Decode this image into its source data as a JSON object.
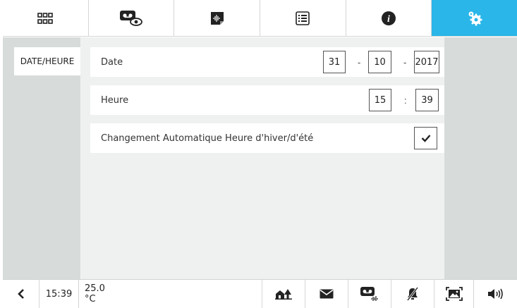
{
  "top_nav": {
    "tabs": [
      {
        "icon": "grid-icon"
      },
      {
        "icon": "voicemail-eye-icon"
      },
      {
        "icon": "audio-note-icon"
      },
      {
        "icon": "list-icon"
      },
      {
        "icon": "info-icon"
      },
      {
        "icon": "settings-gears-icon",
        "active": true
      }
    ]
  },
  "sidebar": {
    "items": [
      {
        "label": "DATE/HEURE"
      }
    ]
  },
  "date_row": {
    "label": "Date",
    "day": "31",
    "month": "10",
    "year": "2017",
    "sep": "-"
  },
  "time_row": {
    "label": "Heure",
    "hour": "15",
    "minute": "39",
    "sep": ":"
  },
  "dst_row": {
    "label": "Changement Automatique Heure d'hiver/d'été",
    "checked": true
  },
  "bottom_bar": {
    "back_icon": "chevron-left-icon",
    "time": "15:39",
    "temperature": "25.0 °C",
    "icons": [
      "house-tree-icon",
      "envelope-icon",
      "voicemail-audio-icon",
      "bell-muted-icon",
      "picture-frame-icon",
      "speaker-volume-icon"
    ]
  },
  "colors": {
    "accent": "#2ab6e8",
    "sidebar": "#d7dcdb",
    "content": "#eff1f1"
  }
}
